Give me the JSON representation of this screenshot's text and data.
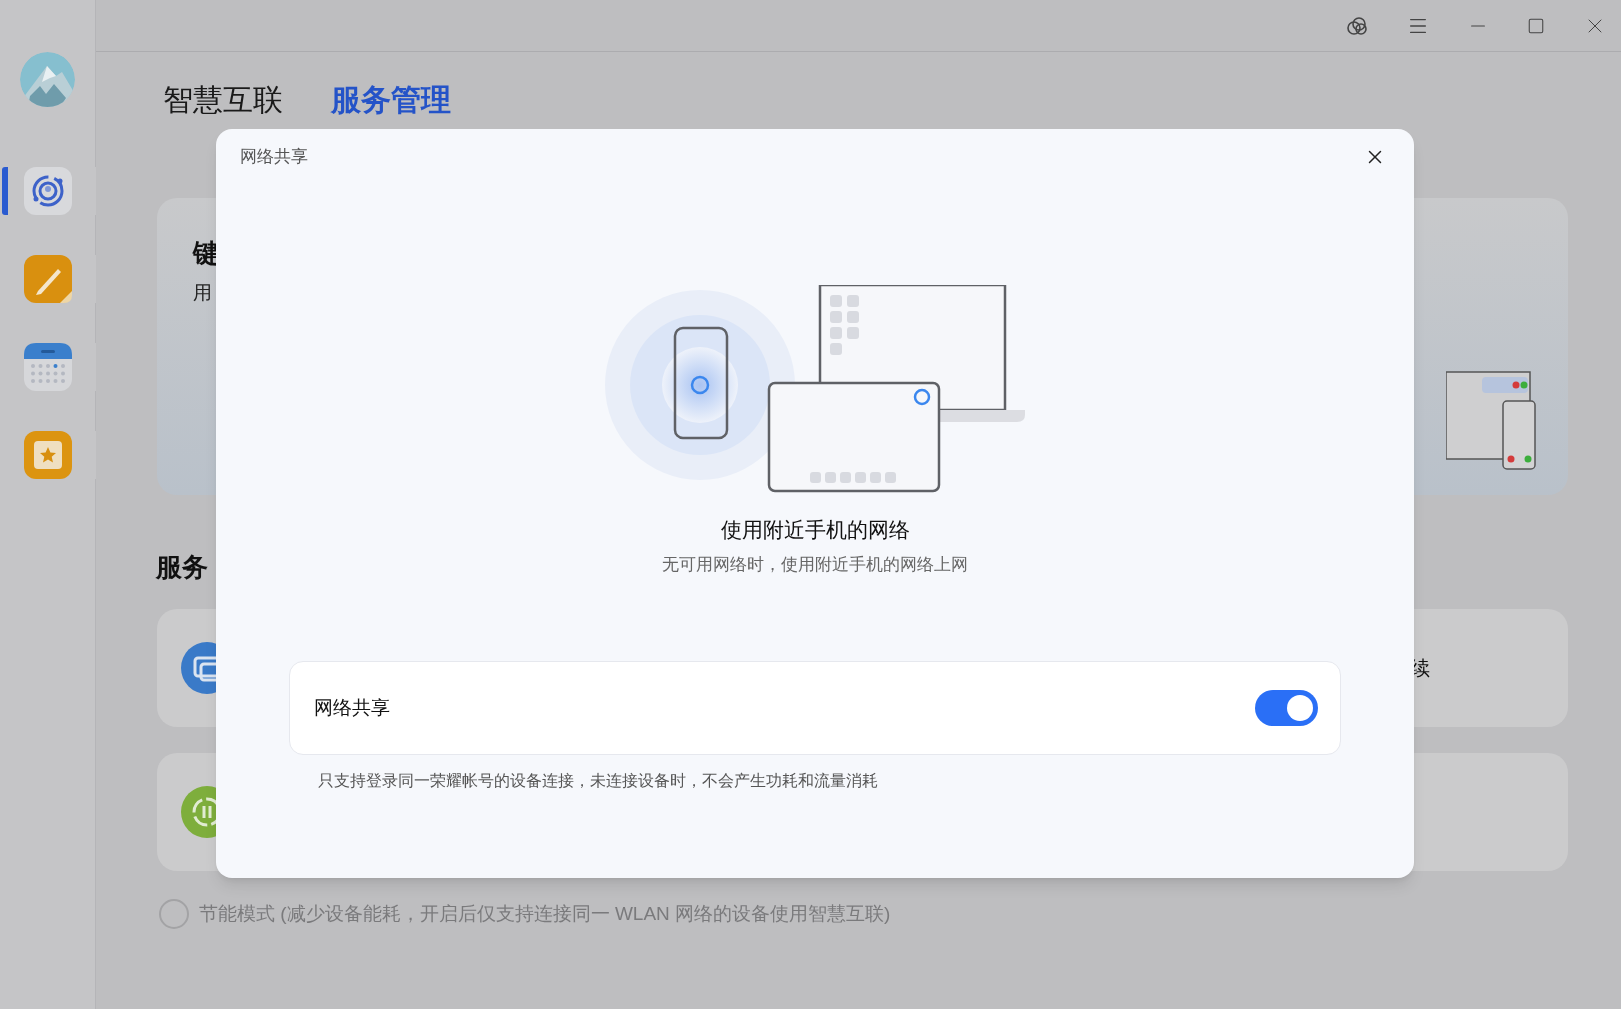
{
  "sidebar": {
    "items": [
      {
        "kind": "connect",
        "selected": true
      },
      {
        "kind": "notes",
        "selected": false
      },
      {
        "kind": "calendar",
        "selected": false
      },
      {
        "kind": "favorites",
        "selected": false
      }
    ]
  },
  "tabs": [
    {
      "label": "智慧互联",
      "selected": false
    },
    {
      "label": "服务管理",
      "selected": true
    }
  ],
  "background": {
    "feature_card": {
      "title": "键",
      "subtitle": "用"
    },
    "section_title": "服务",
    "rows": [
      {
        "kind": "screen",
        "text": "续"
      },
      {
        "kind": "network"
      }
    ],
    "power_saving": {
      "label": "节能模式 (减少设备能耗，开启后仅支持连接同一 WLAN 网络的设备使用智慧互联)",
      "checked": false
    }
  },
  "dialog": {
    "title": "网络共享",
    "heading": "使用附近手机的网络",
    "description": "无可用网络时，使用附近手机的网络上网",
    "setting": {
      "label": "网络共享",
      "on": true
    },
    "note": "只支持登录同一荣耀帐号的设备连接，未连接设备时，不会产生功耗和流量消耗"
  }
}
